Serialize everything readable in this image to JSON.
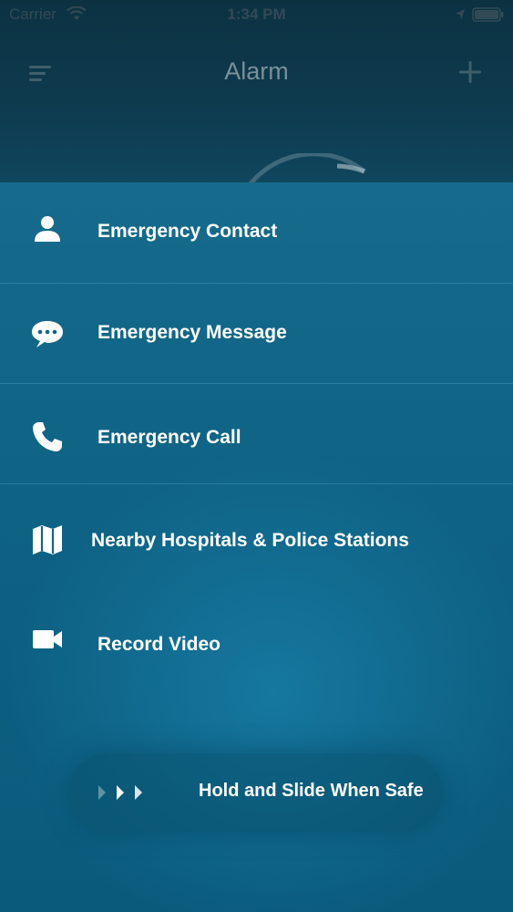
{
  "status_bar": {
    "carrier": "Carrier",
    "time": "1:34 PM",
    "icons": [
      "wifi-icon",
      "location-icon",
      "battery-icon"
    ]
  },
  "nav_bar": {
    "title": "Alarm",
    "left_icon": "menu-icon",
    "right_icon": "add-icon"
  },
  "menu": {
    "items": [
      {
        "label": "Emergency Contact",
        "icon": "person-icon"
      },
      {
        "label": "Emergency Message",
        "icon": "chat-bubble-icon"
      },
      {
        "label": "Emergency Call",
        "icon": "phone-icon"
      },
      {
        "label": "Nearby Hospitals & Police Stations",
        "icon": "map-icon"
      },
      {
        "label": "Record Video",
        "icon": "video-camera-icon"
      }
    ]
  },
  "slider": {
    "label": "Hold and Slide When Safe",
    "icon": "chevrons-right-icon"
  },
  "colors": {
    "panel_top": "#166b8c",
    "panel_bottom": "#0a5a7b",
    "header": "#0c3242",
    "text": "#ffffff"
  }
}
